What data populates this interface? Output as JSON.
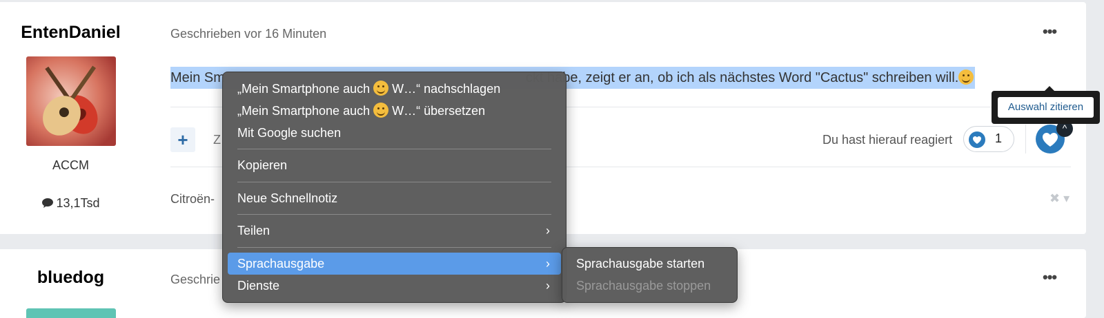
{
  "post1": {
    "author": "EntenDaniel",
    "rank": "ACCM",
    "post_count": "13,1Tsd",
    "meta": "Geschrieben vor 16 Minuten",
    "body_start": "Mein Sm",
    "body_end": "ckt habe, zeigt er an, ob ich als nächstes Word \"Cactus\" schreiben will.",
    "action_partial": "Z",
    "reacted_label": "Du hast hierauf reagiert",
    "reaction_count": "1",
    "signature_partial": "Citroën-",
    "caret": "^",
    "close": "✖ ▾",
    "more": "•••"
  },
  "tooltip": {
    "label": "Auswahl zitieren"
  },
  "context_menu": {
    "items": [
      {
        "pre": "„Mein Smartphone auch",
        "post": "W…“ nachschlagen"
      },
      {
        "pre": "„Mein Smartphone auch",
        "post": "W…“ übersetzen"
      },
      {
        "label": "Mit Google suchen"
      },
      {
        "label": "Kopieren"
      },
      {
        "label": "Neue Schnellnotiz"
      },
      {
        "label": "Teilen"
      },
      {
        "label": "Sprachausgabe"
      },
      {
        "label": "Dienste"
      }
    ],
    "arrow": "›"
  },
  "submenu": {
    "items": [
      {
        "label": "Sprachausgabe starten"
      },
      {
        "label": "Sprachausgabe stoppen"
      }
    ]
  },
  "post2": {
    "author": "bluedog",
    "meta": "Geschrie",
    "more": "•••"
  },
  "colors": {
    "highlight": "#5b9be8",
    "selection": "#b3d4fc",
    "reaction": "#2b7bbd",
    "menu_bg": "#5c5c5c"
  }
}
